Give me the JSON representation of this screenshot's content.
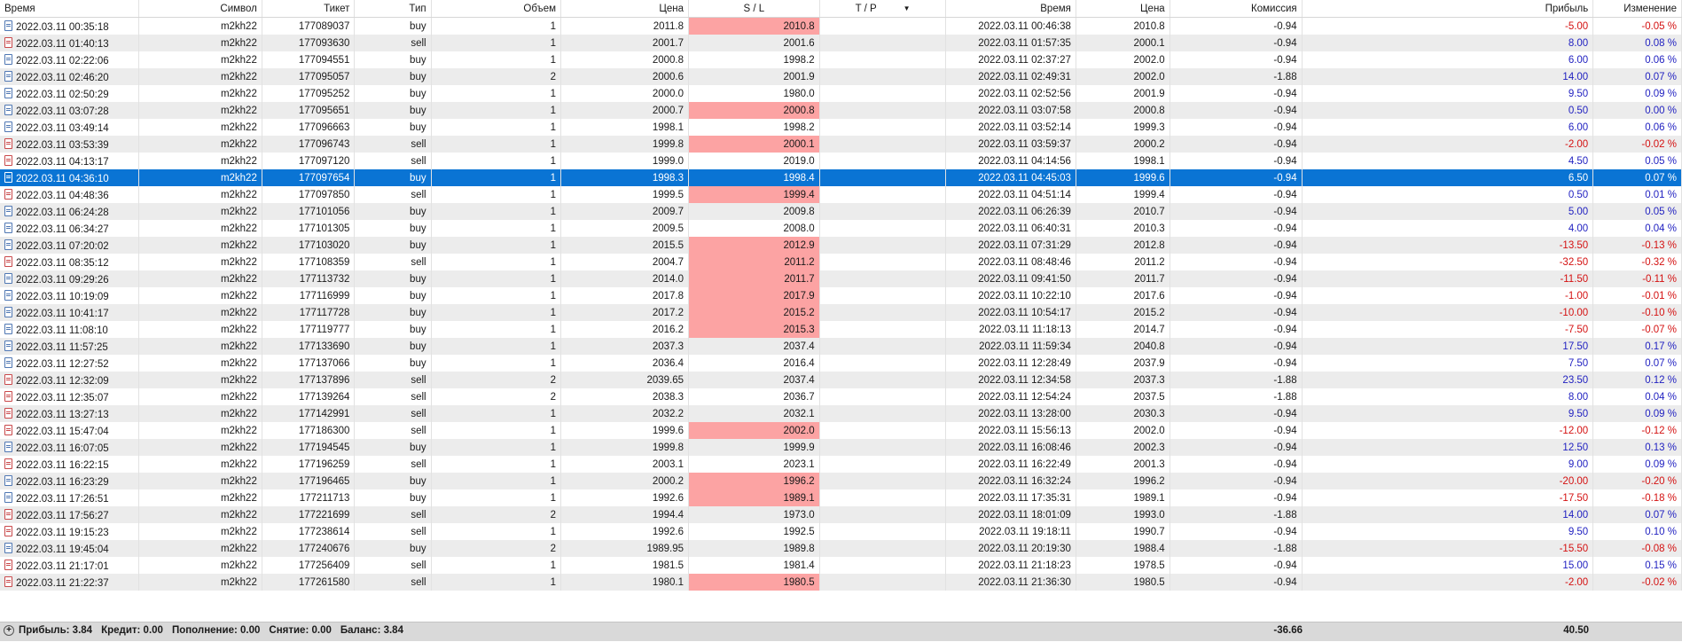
{
  "columns": [
    "Время",
    "Символ",
    "Тикет",
    "Тип",
    "Объем",
    "Цена",
    "S / L",
    "T / P",
    "Время",
    "Цена",
    "Комиссия",
    "Прибыль",
    "Изменение"
  ],
  "rows": [
    {
      "open_time": "2022.03.11 00:35:18",
      "symbol": "m2kh22",
      "ticket": "177089037",
      "type": "buy",
      "volume": "1",
      "open_price": "2011.8",
      "sl": "2010.8",
      "sl_hit": true,
      "tp": "",
      "close_time": "2022.03.11 00:46:38",
      "close_price": "2010.8",
      "commission": "-0.94",
      "profit": "-5.00",
      "change": "-0.05 %"
    },
    {
      "open_time": "2022.03.11 01:40:13",
      "symbol": "m2kh22",
      "ticket": "177093630",
      "type": "sell",
      "volume": "1",
      "open_price": "2001.7",
      "sl": "2001.6",
      "sl_hit": false,
      "tp": "",
      "close_time": "2022.03.11 01:57:35",
      "close_price": "2000.1",
      "commission": "-0.94",
      "profit": "8.00",
      "change": "0.08 %"
    },
    {
      "open_time": "2022.03.11 02:22:06",
      "symbol": "m2kh22",
      "ticket": "177094551",
      "type": "buy",
      "volume": "1",
      "open_price": "2000.8",
      "sl": "1998.2",
      "sl_hit": false,
      "tp": "",
      "close_time": "2022.03.11 02:37:27",
      "close_price": "2002.0",
      "commission": "-0.94",
      "profit": "6.00",
      "change": "0.06 %"
    },
    {
      "open_time": "2022.03.11 02:46:20",
      "symbol": "m2kh22",
      "ticket": "177095057",
      "type": "buy",
      "volume": "2",
      "open_price": "2000.6",
      "sl": "2001.9",
      "sl_hit": false,
      "tp": "",
      "close_time": "2022.03.11 02:49:31",
      "close_price": "2002.0",
      "commission": "-1.88",
      "profit": "14.00",
      "change": "0.07 %"
    },
    {
      "open_time": "2022.03.11 02:50:29",
      "symbol": "m2kh22",
      "ticket": "177095252",
      "type": "buy",
      "volume": "1",
      "open_price": "2000.0",
      "sl": "1980.0",
      "sl_hit": false,
      "tp": "",
      "close_time": "2022.03.11 02:52:56",
      "close_price": "2001.9",
      "commission": "-0.94",
      "profit": "9.50",
      "change": "0.09 %"
    },
    {
      "open_time": "2022.03.11 03:07:28",
      "symbol": "m2kh22",
      "ticket": "177095651",
      "type": "buy",
      "volume": "1",
      "open_price": "2000.7",
      "sl": "2000.8",
      "sl_hit": true,
      "tp": "",
      "close_time": "2022.03.11 03:07:58",
      "close_price": "2000.8",
      "commission": "-0.94",
      "profit": "0.50",
      "change": "0.00 %"
    },
    {
      "open_time": "2022.03.11 03:49:14",
      "symbol": "m2kh22",
      "ticket": "177096663",
      "type": "buy",
      "volume": "1",
      "open_price": "1998.1",
      "sl": "1998.2",
      "sl_hit": false,
      "tp": "",
      "close_time": "2022.03.11 03:52:14",
      "close_price": "1999.3",
      "commission": "-0.94",
      "profit": "6.00",
      "change": "0.06 %"
    },
    {
      "open_time": "2022.03.11 03:53:39",
      "symbol": "m2kh22",
      "ticket": "177096743",
      "type": "sell",
      "volume": "1",
      "open_price": "1999.8",
      "sl": "2000.1",
      "sl_hit": true,
      "tp": "",
      "close_time": "2022.03.11 03:59:37",
      "close_price": "2000.2",
      "commission": "-0.94",
      "profit": "-2.00",
      "change": "-0.02 %"
    },
    {
      "open_time": "2022.03.11 04:13:17",
      "symbol": "m2kh22",
      "ticket": "177097120",
      "type": "sell",
      "volume": "1",
      "open_price": "1999.0",
      "sl": "2019.0",
      "sl_hit": false,
      "tp": "",
      "close_time": "2022.03.11 04:14:56",
      "close_price": "1998.1",
      "commission": "-0.94",
      "profit": "4.50",
      "change": "0.05 %"
    },
    {
      "open_time": "2022.03.11 04:36:10",
      "symbol": "m2kh22",
      "ticket": "177097654",
      "type": "buy",
      "volume": "1",
      "open_price": "1998.3",
      "sl": "1998.4",
      "sl_hit": false,
      "tp": "",
      "close_time": "2022.03.11 04:45:03",
      "close_price": "1999.6",
      "commission": "-0.94",
      "profit": "6.50",
      "change": "0.07 %",
      "selected": true
    },
    {
      "open_time": "2022.03.11 04:48:36",
      "symbol": "m2kh22",
      "ticket": "177097850",
      "type": "sell",
      "volume": "1",
      "open_price": "1999.5",
      "sl": "1999.4",
      "sl_hit": true,
      "tp": "",
      "close_time": "2022.03.11 04:51:14",
      "close_price": "1999.4",
      "commission": "-0.94",
      "profit": "0.50",
      "change": "0.01 %"
    },
    {
      "open_time": "2022.03.11 06:24:28",
      "symbol": "m2kh22",
      "ticket": "177101056",
      "type": "buy",
      "volume": "1",
      "open_price": "2009.7",
      "sl": "2009.8",
      "sl_hit": false,
      "tp": "",
      "close_time": "2022.03.11 06:26:39",
      "close_price": "2010.7",
      "commission": "-0.94",
      "profit": "5.00",
      "change": "0.05 %"
    },
    {
      "open_time": "2022.03.11 06:34:27",
      "symbol": "m2kh22",
      "ticket": "177101305",
      "type": "buy",
      "volume": "1",
      "open_price": "2009.5",
      "sl": "2008.0",
      "sl_hit": false,
      "tp": "",
      "close_time": "2022.03.11 06:40:31",
      "close_price": "2010.3",
      "commission": "-0.94",
      "profit": "4.00",
      "change": "0.04 %"
    },
    {
      "open_time": "2022.03.11 07:20:02",
      "symbol": "m2kh22",
      "ticket": "177103020",
      "type": "buy",
      "volume": "1",
      "open_price": "2015.5",
      "sl": "2012.9",
      "sl_hit": true,
      "tp": "",
      "close_time": "2022.03.11 07:31:29",
      "close_price": "2012.8",
      "commission": "-0.94",
      "profit": "-13.50",
      "change": "-0.13 %"
    },
    {
      "open_time": "2022.03.11 08:35:12",
      "symbol": "m2kh22",
      "ticket": "177108359",
      "type": "sell",
      "volume": "1",
      "open_price": "2004.7",
      "sl": "2011.2",
      "sl_hit": true,
      "tp": "",
      "close_time": "2022.03.11 08:48:46",
      "close_price": "2011.2",
      "commission": "-0.94",
      "profit": "-32.50",
      "change": "-0.32 %"
    },
    {
      "open_time": "2022.03.11 09:29:26",
      "symbol": "m2kh22",
      "ticket": "177113732",
      "type": "buy",
      "volume": "1",
      "open_price": "2014.0",
      "sl": "2011.7",
      "sl_hit": true,
      "tp": "",
      "close_time": "2022.03.11 09:41:50",
      "close_price": "2011.7",
      "commission": "-0.94",
      "profit": "-11.50",
      "change": "-0.11 %"
    },
    {
      "open_time": "2022.03.11 10:19:09",
      "symbol": "m2kh22",
      "ticket": "177116999",
      "type": "buy",
      "volume": "1",
      "open_price": "2017.8",
      "sl": "2017.9",
      "sl_hit": true,
      "tp": "",
      "close_time": "2022.03.11 10:22:10",
      "close_price": "2017.6",
      "commission": "-0.94",
      "profit": "-1.00",
      "change": "-0.01 %"
    },
    {
      "open_time": "2022.03.11 10:41:17",
      "symbol": "m2kh22",
      "ticket": "177117728",
      "type": "buy",
      "volume": "1",
      "open_price": "2017.2",
      "sl": "2015.2",
      "sl_hit": true,
      "tp": "",
      "close_time": "2022.03.11 10:54:17",
      "close_price": "2015.2",
      "commission": "-0.94",
      "profit": "-10.00",
      "change": "-0.10 %"
    },
    {
      "open_time": "2022.03.11 11:08:10",
      "symbol": "m2kh22",
      "ticket": "177119777",
      "type": "buy",
      "volume": "1",
      "open_price": "2016.2",
      "sl": "2015.3",
      "sl_hit": true,
      "tp": "",
      "close_time": "2022.03.11 11:18:13",
      "close_price": "2014.7",
      "commission": "-0.94",
      "profit": "-7.50",
      "change": "-0.07 %"
    },
    {
      "open_time": "2022.03.11 11:57:25",
      "symbol": "m2kh22",
      "ticket": "177133690",
      "type": "buy",
      "volume": "1",
      "open_price": "2037.3",
      "sl": "2037.4",
      "sl_hit": false,
      "tp": "",
      "close_time": "2022.03.11 11:59:34",
      "close_price": "2040.8",
      "commission": "-0.94",
      "profit": "17.50",
      "change": "0.17 %"
    },
    {
      "open_time": "2022.03.11 12:27:52",
      "symbol": "m2kh22",
      "ticket": "177137066",
      "type": "buy",
      "volume": "1",
      "open_price": "2036.4",
      "sl": "2016.4",
      "sl_hit": false,
      "tp": "",
      "close_time": "2022.03.11 12:28:49",
      "close_price": "2037.9",
      "commission": "-0.94",
      "profit": "7.50",
      "change": "0.07 %"
    },
    {
      "open_time": "2022.03.11 12:32:09",
      "symbol": "m2kh22",
      "ticket": "177137896",
      "type": "sell",
      "volume": "2",
      "open_price": "2039.65",
      "sl": "2037.4",
      "sl_hit": false,
      "tp": "",
      "close_time": "2022.03.11 12:34:58",
      "close_price": "2037.3",
      "commission": "-1.88",
      "profit": "23.50",
      "change": "0.12 %"
    },
    {
      "open_time": "2022.03.11 12:35:07",
      "symbol": "m2kh22",
      "ticket": "177139264",
      "type": "sell",
      "volume": "2",
      "open_price": "2038.3",
      "sl": "2036.7",
      "sl_hit": false,
      "tp": "",
      "close_time": "2022.03.11 12:54:24",
      "close_price": "2037.5",
      "commission": "-1.88",
      "profit": "8.00",
      "change": "0.04 %"
    },
    {
      "open_time": "2022.03.11 13:27:13",
      "symbol": "m2kh22",
      "ticket": "177142991",
      "type": "sell",
      "volume": "1",
      "open_price": "2032.2",
      "sl": "2032.1",
      "sl_hit": false,
      "tp": "",
      "close_time": "2022.03.11 13:28:00",
      "close_price": "2030.3",
      "commission": "-0.94",
      "profit": "9.50",
      "change": "0.09 %"
    },
    {
      "open_time": "2022.03.11 15:47:04",
      "symbol": "m2kh22",
      "ticket": "177186300",
      "type": "sell",
      "volume": "1",
      "open_price": "1999.6",
      "sl": "2002.0",
      "sl_hit": true,
      "tp": "",
      "close_time": "2022.03.11 15:56:13",
      "close_price": "2002.0",
      "commission": "-0.94",
      "profit": "-12.00",
      "change": "-0.12 %"
    },
    {
      "open_time": "2022.03.11 16:07:05",
      "symbol": "m2kh22",
      "ticket": "177194545",
      "type": "buy",
      "volume": "1",
      "open_price": "1999.8",
      "sl": "1999.9",
      "sl_hit": false,
      "tp": "",
      "close_time": "2022.03.11 16:08:46",
      "close_price": "2002.3",
      "commission": "-0.94",
      "profit": "12.50",
      "change": "0.13 %"
    },
    {
      "open_time": "2022.03.11 16:22:15",
      "symbol": "m2kh22",
      "ticket": "177196259",
      "type": "sell",
      "volume": "1",
      "open_price": "2003.1",
      "sl": "2023.1",
      "sl_hit": false,
      "tp": "",
      "close_time": "2022.03.11 16:22:49",
      "close_price": "2001.3",
      "commission": "-0.94",
      "profit": "9.00",
      "change": "0.09 %"
    },
    {
      "open_time": "2022.03.11 16:23:29",
      "symbol": "m2kh22",
      "ticket": "177196465",
      "type": "buy",
      "volume": "1",
      "open_price": "2000.2",
      "sl": "1996.2",
      "sl_hit": true,
      "tp": "",
      "close_time": "2022.03.11 16:32:24",
      "close_price": "1996.2",
      "commission": "-0.94",
      "profit": "-20.00",
      "change": "-0.20 %"
    },
    {
      "open_time": "2022.03.11 17:26:51",
      "symbol": "m2kh22",
      "ticket": "177211713",
      "type": "buy",
      "volume": "1",
      "open_price": "1992.6",
      "sl": "1989.1",
      "sl_hit": true,
      "tp": "",
      "close_time": "2022.03.11 17:35:31",
      "close_price": "1989.1",
      "commission": "-0.94",
      "profit": "-17.50",
      "change": "-0.18 %"
    },
    {
      "open_time": "2022.03.11 17:56:27",
      "symbol": "m2kh22",
      "ticket": "177221699",
      "type": "sell",
      "volume": "2",
      "open_price": "1994.4",
      "sl": "1973.0",
      "sl_hit": false,
      "tp": "",
      "close_time": "2022.03.11 18:01:09",
      "close_price": "1993.0",
      "commission": "-1.88",
      "profit": "14.00",
      "change": "0.07 %"
    },
    {
      "open_time": "2022.03.11 19:15:23",
      "symbol": "m2kh22",
      "ticket": "177238614",
      "type": "sell",
      "volume": "1",
      "open_price": "1992.6",
      "sl": "1992.5",
      "sl_hit": false,
      "tp": "",
      "close_time": "2022.03.11 19:18:11",
      "close_price": "1990.7",
      "commission": "-0.94",
      "profit": "9.50",
      "change": "0.10 %"
    },
    {
      "open_time": "2022.03.11 19:45:04",
      "symbol": "m2kh22",
      "ticket": "177240676",
      "type": "buy",
      "volume": "2",
      "open_price": "1989.95",
      "sl": "1989.8",
      "sl_hit": false,
      "tp": "",
      "close_time": "2022.03.11 20:19:30",
      "close_price": "1988.4",
      "commission": "-1.88",
      "profit": "-15.50",
      "change": "-0.08 %"
    },
    {
      "open_time": "2022.03.11 21:17:01",
      "symbol": "m2kh22",
      "ticket": "177256409",
      "type": "sell",
      "volume": "1",
      "open_price": "1981.5",
      "sl": "1981.4",
      "sl_hit": false,
      "tp": "",
      "close_time": "2022.03.11 21:18:23",
      "close_price": "1978.5",
      "commission": "-0.94",
      "profit": "15.00",
      "change": "0.15 %"
    },
    {
      "open_time": "2022.03.11 21:22:37",
      "symbol": "m2kh22",
      "ticket": "177261580",
      "type": "sell",
      "volume": "1",
      "open_price": "1980.1",
      "sl": "1980.5",
      "sl_hit": true,
      "tp": "",
      "close_time": "2022.03.11 21:36:30",
      "close_price": "1980.5",
      "commission": "-0.94",
      "profit": "-2.00",
      "change": "-0.02 %"
    }
  ],
  "footer": {
    "profit": "Прибыль: 3.84",
    "credit": "Кредит: 0.00",
    "deposit": "Пополнение: 0.00",
    "withdrawal": "Снятие: 0.00",
    "balance": "Баланс: 3.84",
    "total_commission": "-36.66",
    "total_profit": "40.50"
  },
  "colors": {
    "selected_row": "#0a74d4",
    "sl_highlight": "#fca3a3",
    "negative": "#d41111",
    "positive": "#1f1fc0"
  },
  "icons": {
    "buy": "deal-buy-icon",
    "sell": "deal-sell-icon",
    "footer": "expand-plus-icon",
    "sort": "sort-desc-icon"
  }
}
